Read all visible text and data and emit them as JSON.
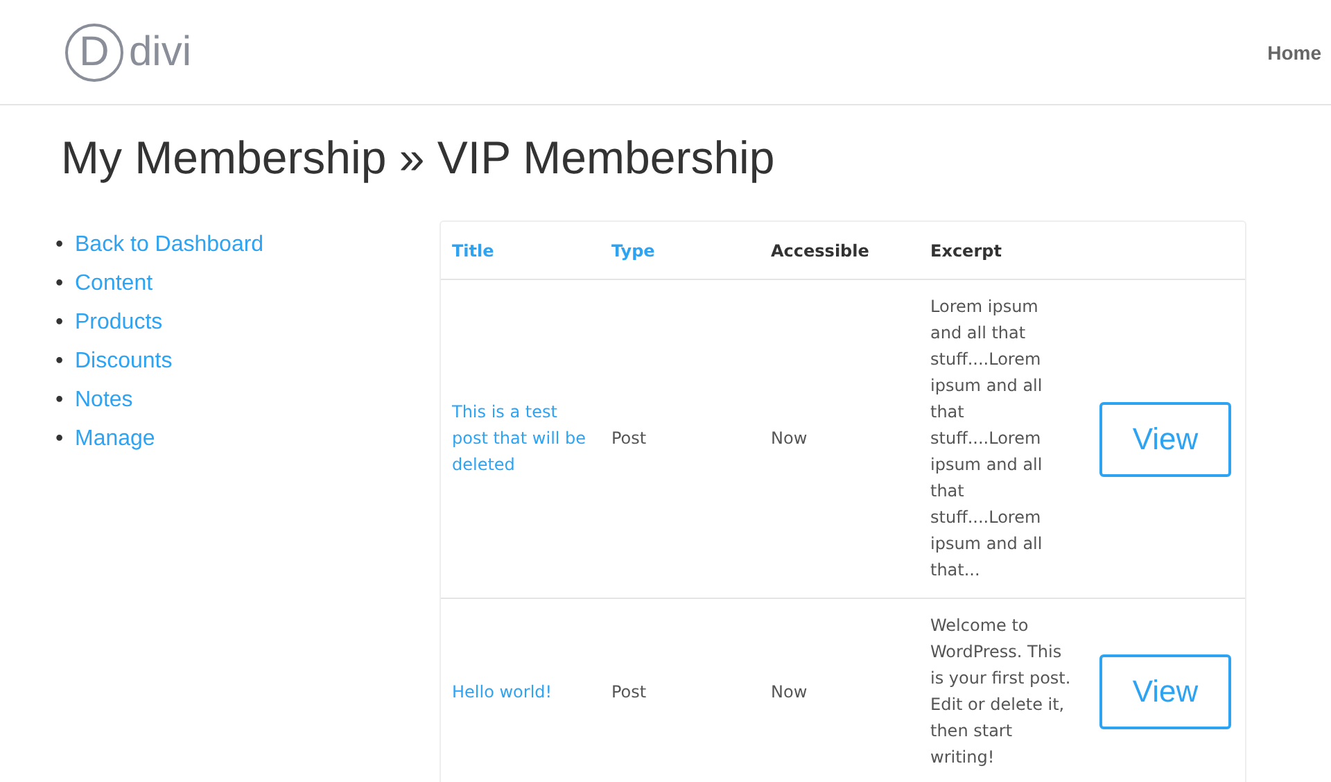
{
  "header": {
    "logo": {
      "letter": "D",
      "name": "divi"
    },
    "nav": [
      {
        "label": "Home"
      }
    ]
  },
  "page_title": "My Membership » VIP Membership",
  "sidebar": {
    "items": [
      {
        "marker": "•",
        "label": "Back to Dashboard"
      },
      {
        "marker": "•",
        "label": "Content"
      },
      {
        "marker": "•",
        "label": "Products"
      },
      {
        "marker": "•",
        "label": "Discounts"
      },
      {
        "marker": "•",
        "label": "Notes"
      },
      {
        "marker": "•",
        "label": "Manage"
      }
    ]
  },
  "table": {
    "columns": [
      {
        "label": "Title",
        "sortable": true
      },
      {
        "label": "Type",
        "sortable": true
      },
      {
        "label": "Accessible",
        "sortable": false
      },
      {
        "label": "Excerpt",
        "sortable": false
      }
    ],
    "rows": [
      {
        "title": "This is a test post that will be deleted",
        "type": "Post",
        "accessible": "Now",
        "excerpt": "Lorem ipsum and all that stuff....Lorem ipsum and all that stuff....Lorem ipsum and all that stuff....Lorem ipsum and all that...",
        "action": "View"
      },
      {
        "title": "Hello world!",
        "type": "Post",
        "accessible": "Now",
        "excerpt": "Welcome to WordPress. This is your first post. Edit or delete it, then start writing!",
        "action": "View"
      }
    ]
  }
}
